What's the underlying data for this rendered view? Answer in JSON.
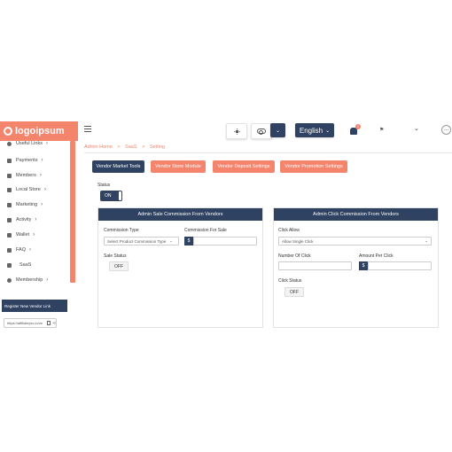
{
  "header": {
    "logo_text": "logoipsum",
    "theme_icon": "sun-icon",
    "toggle_icon": "toggle-icon",
    "language": "English",
    "notification_count": "1",
    "more_label": "..."
  },
  "sidebar": {
    "items": [
      {
        "label": "Useful Links",
        "icon": "info-icon"
      },
      {
        "label": "Payments",
        "icon": "card-icon"
      },
      {
        "label": "Members",
        "icon": "users-icon"
      },
      {
        "label": "Local Store",
        "icon": "store-icon"
      },
      {
        "label": "Marketing",
        "icon": "marketing-icon"
      },
      {
        "label": "Activity",
        "icon": "activity-icon"
      },
      {
        "label": "Wallet",
        "icon": "wallet-icon"
      },
      {
        "label": "FAQ",
        "icon": "faq-icon"
      },
      {
        "label": "SaaS",
        "icon": "saas-icon"
      },
      {
        "label": "Membership",
        "icon": "membership-icon"
      }
    ],
    "vendor_link_label": "Register New Vendor Link",
    "vendor_link_value": "https://affiliatepro.io/ve"
  },
  "breadcrumb": [
    "Admin Home",
    ">",
    "SaaS",
    ">",
    "Setting"
  ],
  "tabs": [
    {
      "label": "Vendor Market Tools",
      "active": true
    },
    {
      "label": "Vendor Store Module",
      "active": false
    },
    {
      "label": "Vendor Deposit Settings",
      "active": false
    },
    {
      "label": "Vendor Promotion Settings",
      "active": false
    }
  ],
  "status": {
    "label": "Status",
    "value": "ON"
  },
  "sale_card": {
    "title": "Admin Sale Commission From Vendors",
    "commission_type_label": "Commission Type",
    "commission_type_value": "Select Product Commission Type",
    "commission_for_sale_label": "Commission For Sale",
    "currency_symbol": "$",
    "sale_status_label": "Sale Status",
    "sale_status_value": "OFF"
  },
  "click_card": {
    "title": "Admin Click Commission From Vendors",
    "click_allow_label": "Click Allow",
    "click_allow_value": "Allow Single Click",
    "number_of_click_label": "Number Of Click",
    "amount_per_click_label": "Amount Per Click",
    "currency_symbol": "$",
    "click_status_label": "Click Status",
    "click_status_value": "OFF"
  },
  "colors": {
    "accent": "#f4846c",
    "navy": "#2f4261"
  }
}
